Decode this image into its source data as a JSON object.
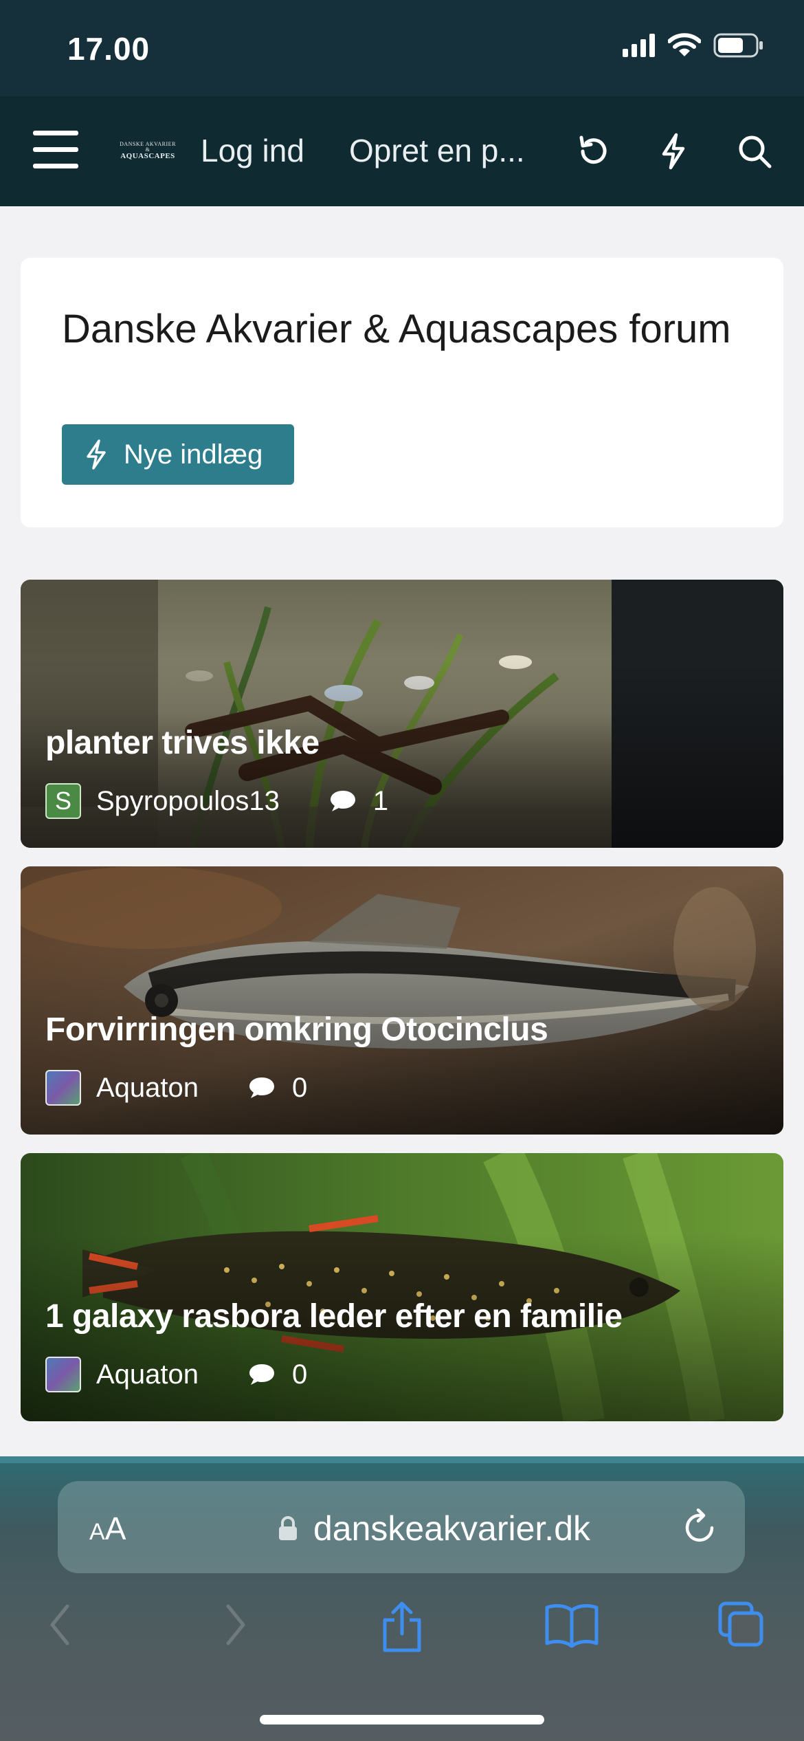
{
  "status_bar": {
    "time": "17.00",
    "icons": [
      "signal-icon",
      "wifi-icon",
      "battery-icon"
    ]
  },
  "nav": {
    "logo_line1": "DANSKE AKVARIER &",
    "logo_line2": "AQUASCAPES",
    "login": "Log ind",
    "register": "Opret en p...",
    "icons": [
      "menu-icon",
      "refresh-icon",
      "lightning-icon",
      "search-icon"
    ]
  },
  "header_card": {
    "title": "Danske Akvarier & Aquascapes forum",
    "button_label": "Nye indlæg"
  },
  "threads": [
    {
      "title": "planter trives ikke",
      "author": "Spyropoulos13",
      "avatar_letter": "S",
      "replies": "1"
    },
    {
      "title": "Forvirringen omkring Otocinclus",
      "author": "Aquaton",
      "avatar_letter": "",
      "replies": "0"
    },
    {
      "title": "1 galaxy rasbora leder efter en familie",
      "author": "Aquaton",
      "avatar_letter": "",
      "replies": "0"
    }
  ],
  "browser": {
    "text_size_small": "A",
    "text_size_large": "A",
    "url": "danskeakvarier.dk",
    "toolbar_icons": [
      "back-icon",
      "forward-icon",
      "share-icon",
      "bookmarks-icon",
      "tabs-icon"
    ]
  },
  "colors": {
    "nav_bg": "#0f2a31",
    "accent": "#2e7d8c",
    "page_bg": "#f2f2f5"
  }
}
